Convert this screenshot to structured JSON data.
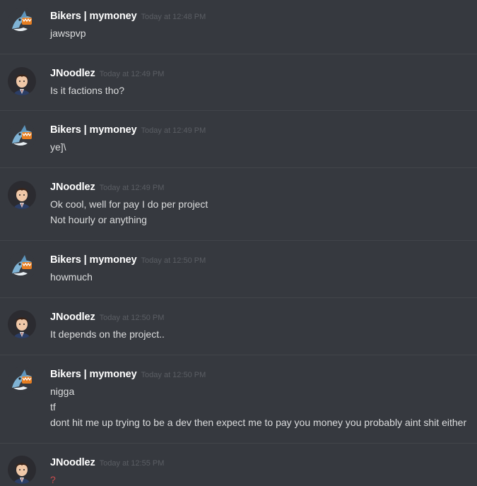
{
  "messages": [
    {
      "author": "Bikers | mymoney",
      "time": "Today at 12:48 PM",
      "avatar": "shark-avatar",
      "lines": [
        "jawspvp"
      ]
    },
    {
      "author": "JNoodlez",
      "time": "Today at 12:49 PM",
      "avatar": "jnoodlez-avatar",
      "lines": [
        "Is it factions tho?"
      ]
    },
    {
      "author": "Bikers | mymoney",
      "time": "Today at 12:49 PM",
      "avatar": "shark-avatar",
      "lines": [
        "ye]\\"
      ]
    },
    {
      "author": "JNoodlez",
      "time": "Today at 12:49 PM",
      "avatar": "jnoodlez-avatar",
      "lines": [
        "Ok cool, well for pay I do per project",
        "Not hourly or anything"
      ]
    },
    {
      "author": "Bikers | mymoney",
      "time": "Today at 12:50 PM",
      "avatar": "shark-avatar",
      "lines": [
        "howmuch"
      ]
    },
    {
      "author": "JNoodlez",
      "time": "Today at 12:50 PM",
      "avatar": "jnoodlez-avatar",
      "lines": [
        "It depends on the project.."
      ]
    },
    {
      "author": "Bikers | mymoney",
      "time": "Today at 12:50 PM",
      "avatar": "shark-avatar",
      "lines": [
        "nigga",
        "tf",
        "dont hit me up trying to be a dev then expect me to pay you money you probably aint shit either"
      ]
    },
    {
      "author": "JNoodlez",
      "time": "Today at 12:55 PM",
      "avatar": "jnoodlez-avatar",
      "lines": [
        "?"
      ]
    }
  ],
  "colors": {
    "background": "#36393f",
    "divider": "#42454a",
    "username": "#ffffff",
    "timestamp": "#5b5e64",
    "text": "#dcddde",
    "question_mark": "#c94d4d"
  }
}
